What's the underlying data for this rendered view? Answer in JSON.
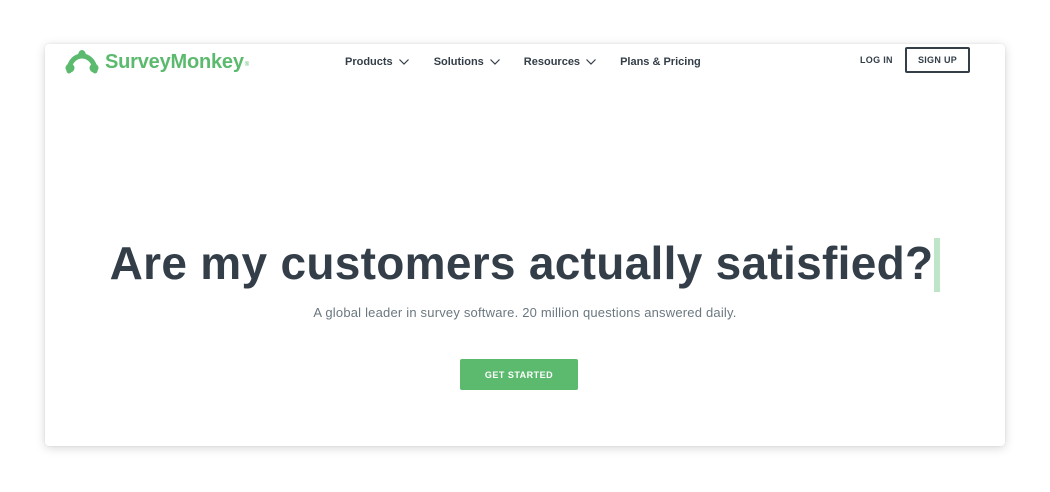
{
  "header": {
    "logo_text": "SurveyMonkey",
    "logo_reg_mark": "®",
    "logo_icon": "monkey-logo-icon",
    "nav": [
      {
        "label": "Products",
        "has_dropdown": true
      },
      {
        "label": "Solutions",
        "has_dropdown": true
      },
      {
        "label": "Resources",
        "has_dropdown": true
      },
      {
        "label": "Plans & Pricing",
        "has_dropdown": false
      }
    ],
    "login_label": "LOG IN",
    "signup_label": "SIGN UP"
  },
  "hero": {
    "headline": "Are my customers actually satisfied?",
    "subtitle": "A global leader in survey software. 20 million questions answered daily.",
    "cta_label": "GET STARTED"
  },
  "colors": {
    "brand_green": "#5cba6e",
    "text_dark": "#333e48",
    "text_muted": "#6b787f",
    "cursor_highlight": "#bfe5c8"
  }
}
